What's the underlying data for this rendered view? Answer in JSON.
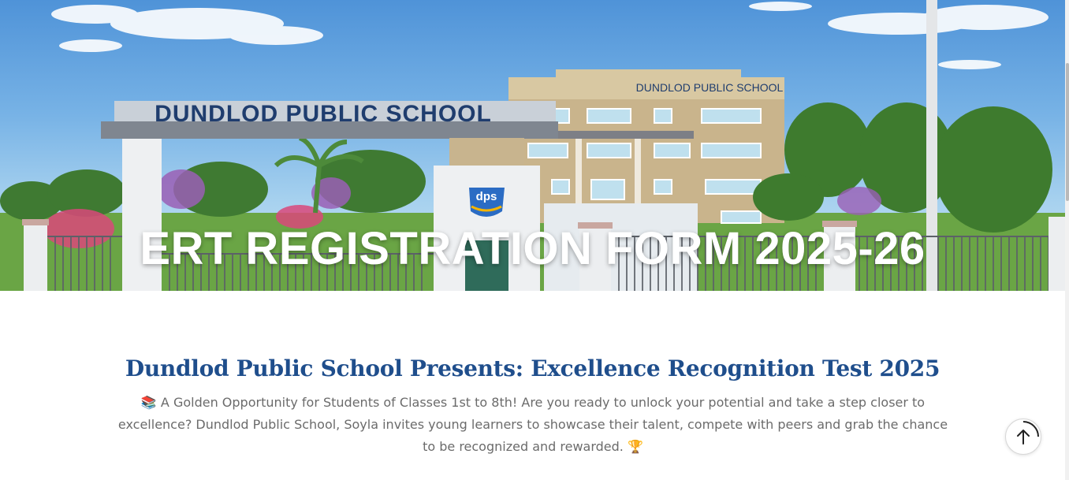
{
  "hero": {
    "title": "ERT REGISTRATION FORM 2025-26",
    "gate_sign": "DUNDLOD PUBLIC SCHOOL",
    "building_sign": "DUNDLOD PUBLIC SCHOOL",
    "logo_text": "dps"
  },
  "main": {
    "heading": "Dundlod Public School Presents: Excellence Recognition Test 2025",
    "intro_emoji_start": "📚",
    "intro_text": "A Golden Opportunity for Students of Classes 1st to 8th! Are you ready to unlock your potential and take a step closer to excellence? Dundlod Public School, Soyla invites young learners to showcase their talent, compete with peers and grab the chance to be recognized and rewarded.",
    "intro_emoji_end": "🏆"
  },
  "colors": {
    "heading": "#1f4e8c",
    "body_text": "#6b6b6b",
    "hero_title": "#ffffff"
  },
  "icons": {
    "back_to_top": "arrow-up-icon"
  }
}
